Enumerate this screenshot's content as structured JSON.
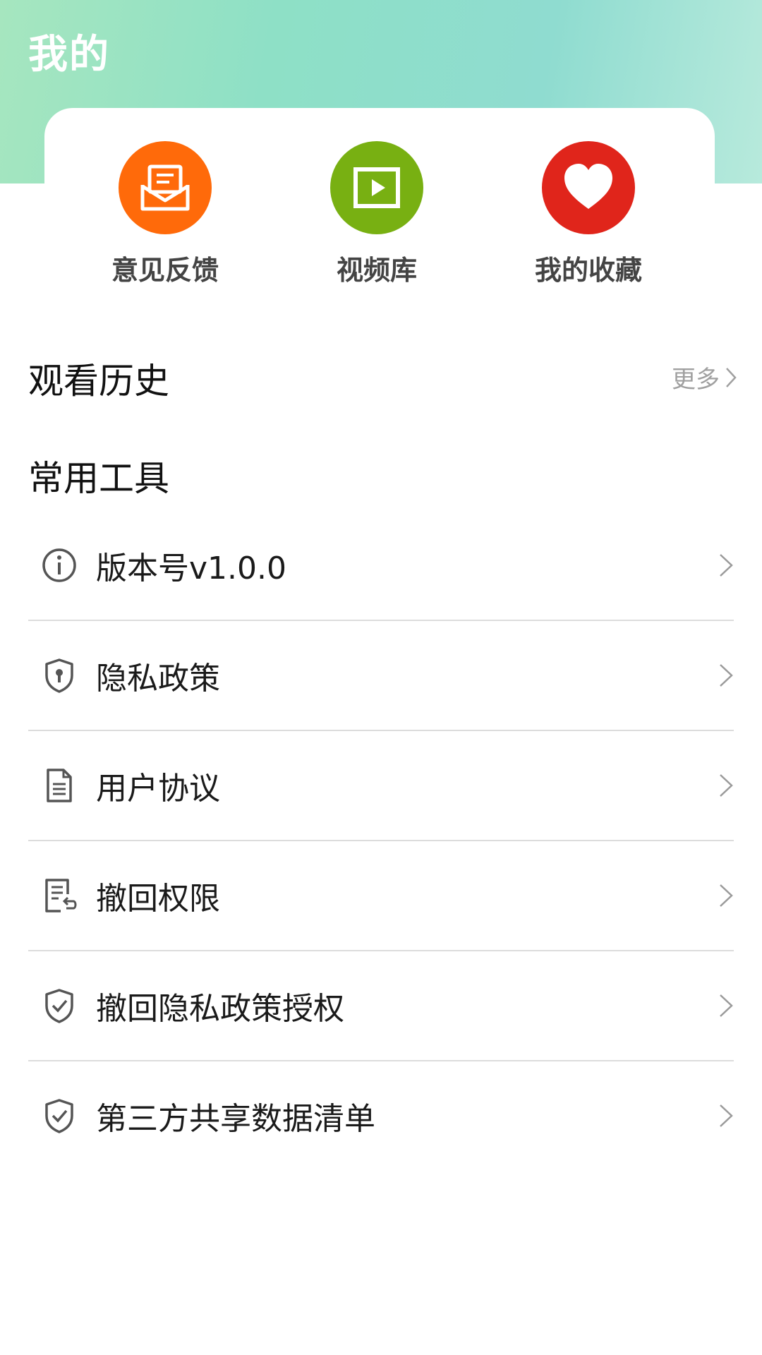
{
  "header": {
    "title": "我的"
  },
  "shortcuts": [
    {
      "label": "意见反馈",
      "icon": "feedback-envelope-icon",
      "color": "#ff6a0a"
    },
    {
      "label": "视频库",
      "icon": "video-play-icon",
      "color": "#78b012"
    },
    {
      "label": "我的收藏",
      "icon": "heart-icon",
      "color": "#e0251b"
    }
  ],
  "history": {
    "title": "观看历史",
    "more_label": "更多"
  },
  "tools": {
    "title": "常用工具",
    "items": [
      {
        "label": "版本号v1.0.0",
        "icon": "info-icon"
      },
      {
        "label": "隐私政策",
        "icon": "shield-lock-icon"
      },
      {
        "label": "用户协议",
        "icon": "document-icon"
      },
      {
        "label": "撤回权限",
        "icon": "document-revoke-icon"
      },
      {
        "label": "撤回隐私政策授权",
        "icon": "shield-check-icon"
      },
      {
        "label": "第三方共享数据清单",
        "icon": "shield-check-icon"
      }
    ]
  }
}
